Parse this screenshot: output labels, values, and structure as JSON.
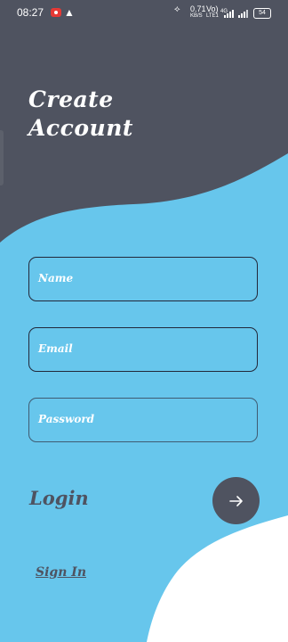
{
  "status_bar": {
    "time": "08:27",
    "speed_value": "0.71",
    "speed_unit": "KB/S",
    "net_top": "Vo)",
    "net_mid": "LTE1",
    "net_bottom": "4G",
    "battery": "54"
  },
  "header": {
    "title_line1": "Create",
    "title_line2": "Account"
  },
  "form": {
    "name_placeholder": "Name",
    "email_placeholder": "Email",
    "password_placeholder": "Password"
  },
  "actions": {
    "login_label": "Login",
    "sign_in_label": "Sign In"
  },
  "colors": {
    "dark": "#4f5360",
    "blue": "#67c6ec",
    "white": "#ffffff",
    "field_border": "#22283a"
  },
  "icons": [
    "record-icon",
    "warning-icon",
    "arrow-right-icon"
  ]
}
